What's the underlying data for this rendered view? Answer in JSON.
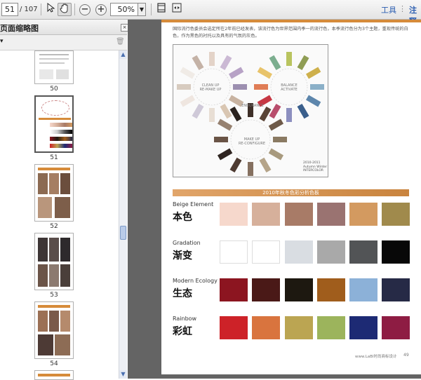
{
  "toolbar": {
    "current_page": "51",
    "total_pages": "/ 107",
    "zoom": "50%",
    "tools_label": "工具",
    "comment_label": "注释",
    "icons": [
      "select-cursor-icon",
      "hand-tool-icon",
      "zoom-out-icon",
      "zoom-in-icon",
      "fit-page-icon",
      "fit-width-icon"
    ]
  },
  "sidebar": {
    "title": "页面缩略图",
    "thumbnails": [
      {
        "label": "50"
      },
      {
        "label": "51"
      },
      {
        "label": "52"
      },
      {
        "label": "53"
      },
      {
        "label": "54"
      }
    ]
  },
  "document": {
    "intro_text": "国际流行色委员会选定所在2年前已经发表，该流行色为世界范围内季一的流行色，本季流行色分为3个主题，重现传统的白色，作为黑色的衬托以及具有的气氛的灰色。",
    "wheel_labels": {
      "cleanup": "CLEAN UP\nRE-MAKE UP",
      "balance": "BALANCE\nACTIVATE",
      "endurance": "ENDURANCE",
      "remake": "MAKE UP\nRE-CONFIGURE",
      "season": "2010-2011\nAutumn Winter\nINTERCOLOR"
    },
    "section_title": "2010年秋冬色彩分析色板",
    "footer": "www.LaBl时尚商标设计",
    "page_number": "49",
    "palettes": [
      {
        "en": "Beige Element",
        "zh": "本色",
        "colors": [
          "#f6d8cc",
          "#d6b09b",
          "#a87b67",
          "#9a7371",
          "#d39a60",
          "#a08a4c"
        ]
      },
      {
        "en": "Gradation",
        "zh": "渐变",
        "colors": [
          "#ffffff",
          "#ffffff",
          "#d9dde2",
          "#a9a9a9",
          "#525456",
          "#080808"
        ]
      },
      {
        "en": "Modern Ecology",
        "zh": "生态",
        "colors": [
          "#8c1520",
          "#4a1917",
          "#1d1810",
          "#a05d1c",
          "#8cb1d8",
          "#262a46"
        ]
      },
      {
        "en": "Rainbow",
        "zh": "彩虹",
        "colors": [
          "#cd2228",
          "#d9743e",
          "#bba552",
          "#9cb45c",
          "#1d2a74",
          "#8e1c43"
        ]
      }
    ]
  }
}
